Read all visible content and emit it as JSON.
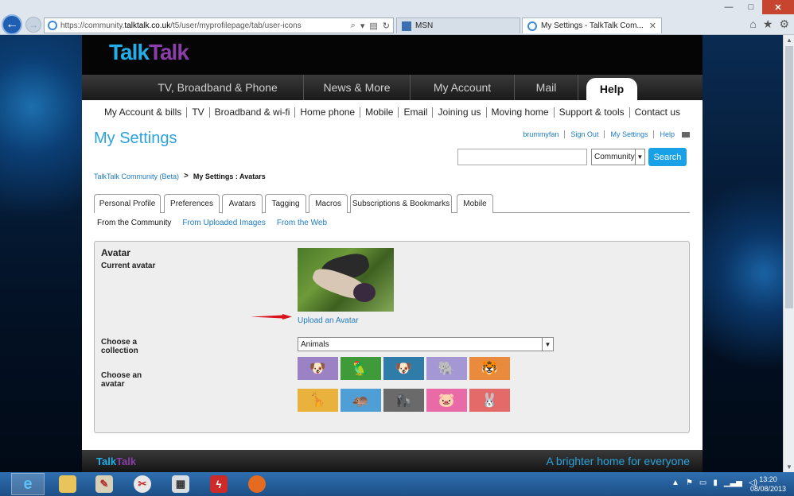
{
  "browser": {
    "url_prefix": "https://community.",
    "url_host": "talktalk.co.uk",
    "url_path": "/t5/user/myprofilepage/tab/user-icons",
    "tabs": [
      {
        "label": "MSN"
      },
      {
        "label": "My Settings - TalkTalk Com..."
      }
    ],
    "window_controls": {
      "minimize": "—",
      "maximize": "□",
      "close": "✕"
    }
  },
  "site": {
    "logo_a": "Talk",
    "logo_b": "Talk",
    "main_nav": [
      {
        "label": "TV, Broadband & Phone"
      },
      {
        "label": "News & More"
      },
      {
        "label": "My Account"
      },
      {
        "label": "Mail"
      },
      {
        "label": "Help"
      }
    ],
    "sub_nav": [
      "My Account & bills",
      "TV",
      "Broadband & wi-fi",
      "Home phone",
      "Mobile",
      "Email",
      "Joining us",
      "Moving home",
      "Support & tools",
      "Contact us"
    ],
    "page_title": "My Settings",
    "user_links": [
      "brummyfan",
      "Sign Out",
      "My Settings",
      "Help"
    ],
    "search": {
      "placeholder": "",
      "scope": "Community",
      "button": "Search"
    },
    "breadcrumb": {
      "root": "TalkTalk Community (Beta)",
      "separator": ">",
      "current": "My Settings : Avatars"
    },
    "profile_tabs": [
      "Personal Profile",
      "Preferences",
      "Avatars",
      "Tagging",
      "Macros",
      "Subscriptions & Bookmarks",
      "Mobile"
    ],
    "active_profile_tab": "Avatars",
    "avatar_sources": {
      "current": "From the Community",
      "links": [
        "From Uploaded Images",
        "From the Web"
      ]
    },
    "panel": {
      "heading": "Avatar",
      "current_avatar_label": "Current avatar",
      "upload_link": "Upload an Avatar",
      "choose_collection_label": "Choose a collection",
      "collection_value": "Animals",
      "choose_avatar_label": "Choose an avatar",
      "avatars": [
        {
          "name": "dog",
          "color": "#9b82c4",
          "glyph": "🐶"
        },
        {
          "name": "parrot",
          "color": "#3f9a3a",
          "glyph": "🦜"
        },
        {
          "name": "bulldog",
          "color": "#2f7ca8",
          "glyph": "🐶"
        },
        {
          "name": "elephant",
          "color": "#a596d4",
          "glyph": "🐘"
        },
        {
          "name": "tiger",
          "color": "#e98a3c",
          "glyph": "🐯"
        },
        {
          "name": "giraffe",
          "color": "#e8b23c",
          "glyph": "🦒"
        },
        {
          "name": "hippo",
          "color": "#4f9fd6",
          "glyph": "🦛"
        },
        {
          "name": "gorilla",
          "color": "#6a6a6a",
          "glyph": "🦍"
        },
        {
          "name": "pig",
          "color": "#e86aa6",
          "glyph": "🐷"
        },
        {
          "name": "rabbit",
          "color": "#e46a6a",
          "glyph": "🐰"
        }
      ]
    },
    "footer": {
      "logo_a": "Talk",
      "logo_b": "Talk",
      "tagline": "A brighter home for everyone"
    }
  },
  "taskbar": {
    "time": "13:20",
    "date": "08/08/2013"
  }
}
